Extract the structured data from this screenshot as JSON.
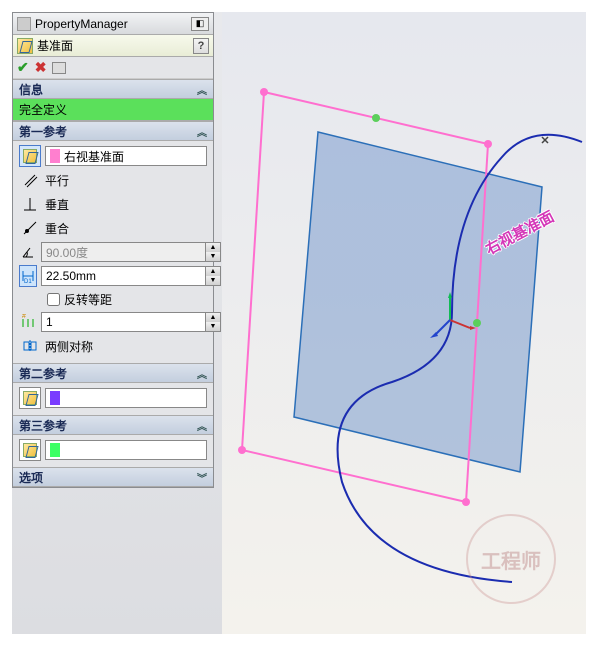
{
  "header": {
    "title": "PropertyManager"
  },
  "feature": {
    "name": "基准面",
    "help": "?"
  },
  "actions": {
    "ok": "✔",
    "cancel": "✖"
  },
  "info": {
    "header": "信息",
    "status": "完全定义"
  },
  "ref1": {
    "header": "第一参考",
    "selection": "右视基准面",
    "parallel": "平行",
    "perpendicular": "垂直",
    "coincident": "重合",
    "angle_value": "90.00度",
    "distance_value": "22.50mm",
    "flip": "反转等距",
    "instances_value": "1",
    "symmetric": "两侧对称"
  },
  "ref2": {
    "header": "第二参考",
    "selection": ""
  },
  "ref3": {
    "header": "第三参考",
    "selection": ""
  },
  "options": {
    "header": "选项"
  },
  "scene": {
    "plane_label": "右视基准面"
  },
  "watermark": {
    "text": "工程师"
  },
  "colors": {
    "swatch1": "#ff7fcf",
    "swatch2": "#7a3cff",
    "swatch3": "#3cff64"
  }
}
